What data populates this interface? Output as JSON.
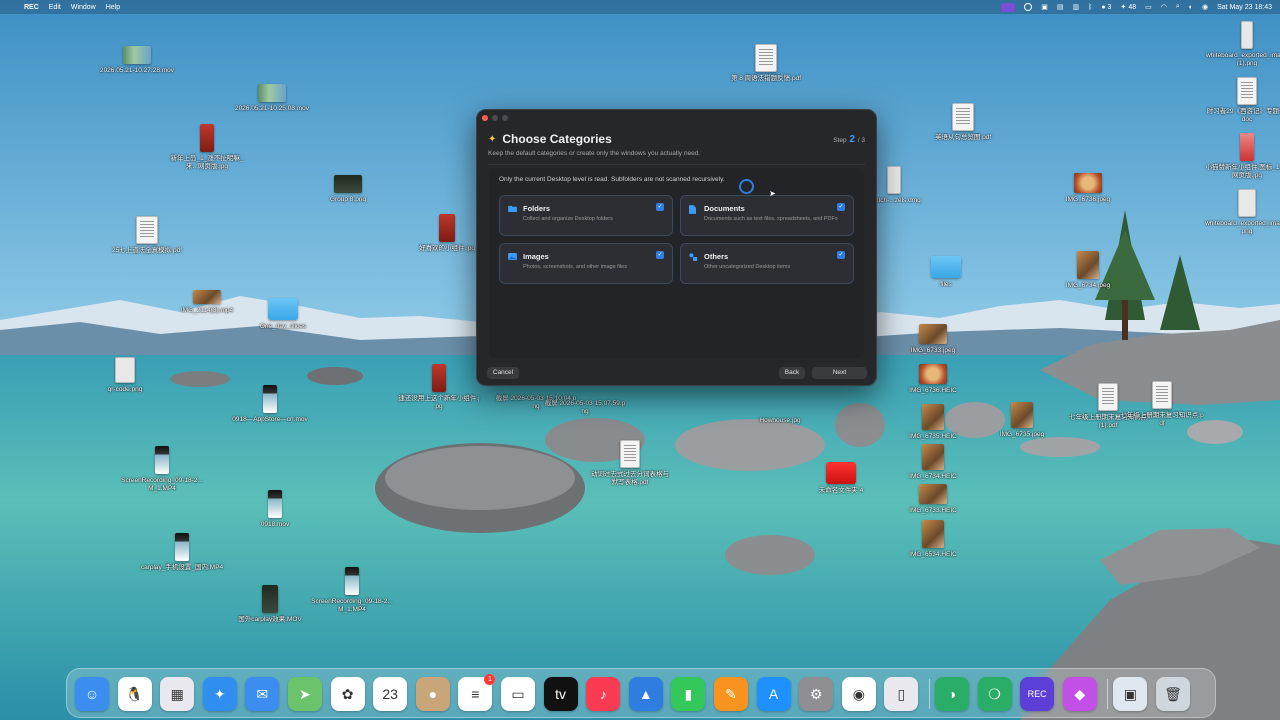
{
  "menubar": {
    "app_name": "REC",
    "menus": [
      "Edit",
      "Window",
      "Help"
    ],
    "notif_count": "3",
    "wechat_count": "48",
    "datetime": "Sat May 23  18:43"
  },
  "desktop_icons": [
    {
      "label": "2026.05.21-10.27.28.mov",
      "type": "video"
    },
    {
      "label": "2026.05.21-10.25.08.mov",
      "type": "video"
    },
    {
      "label": "新年上岛_1_涨不扯呢嘛_来...网页版.jpg",
      "type": "red"
    },
    {
      "label": "Group 8.png",
      "type": "dark"
    },
    {
      "label": "25七上道法全真模拟.pdf",
      "type": "doc"
    },
    {
      "label": "好喜欢的小组件.jpg",
      "type": "red"
    },
    {
      "label": "IMG_2114(3).mp4",
      "type": "photo"
    },
    {
      "label": "One_day_slices",
      "type": "folder"
    },
    {
      "label": "qr-code.png",
      "type": "gray"
    },
    {
      "label": "0918—AppStore—cn.mov",
      "type": "phone"
    },
    {
      "label": "速还没用上这个新年小组件.jpg",
      "type": "red"
    },
    {
      "label": "截屏 2026-05-03 15.10.04.png",
      "type": "gray"
    },
    {
      "label": "截屏 2026-05-03 15.07.59.png",
      "type": "gray"
    },
    {
      "label": "ScreenRecording_09-18-2...M_1.MP4",
      "type": "phone"
    },
    {
      "label": "0918.mov",
      "type": "phone"
    },
    {
      "label": "carplay_手机设置_国内.MP4",
      "type": "phone"
    },
    {
      "label": "ScreenRecording_09-18-2...M_1.MP4",
      "type": "phone"
    },
    {
      "label": "国外carplay效果.MOV",
      "type": "dark"
    },
    {
      "label": "动词过去式过去分词表格与默写表格.pdf",
      "type": "doc"
    },
    {
      "label": "第 8 周语法错题反馈.pdf",
      "type": "doc"
    },
    {
      "label": "英语从句总览图.pdf",
      "type": "doc"
    },
    {
      "label": "Sketch-...zels.dmg",
      "type": "gray"
    },
    {
      "label": "IMG_6736.jpeg",
      "type": "food"
    },
    {
      "label": "IMG_6734.jpeg",
      "type": "photo"
    },
    {
      "label": "files",
      "type": "folder"
    },
    {
      "label": "IMG_6733.jpeg",
      "type": "photo"
    },
    {
      "label": "IMG_6736.HEIC",
      "type": "food"
    },
    {
      "label": "IMG_6735.HEIC",
      "type": "photo"
    },
    {
      "label": "IMG_6735.jpeg",
      "type": "photo"
    },
    {
      "label": "IMG_6734.HEIC",
      "type": "photo"
    },
    {
      "label": "IMG_6733.HEIC",
      "type": "photo"
    },
    {
      "label": "IMG_6534.HEIC",
      "type": "photo"
    },
    {
      "label": "Howhouse.jpg",
      "type": "gray"
    },
    {
      "label": "未命名文件夹 4",
      "type": "folder-red"
    },
    {
      "label": "七年级上册期末复习知识点 (1).pdf",
      "type": "doc"
    },
    {
      "label": "七年级上册期末复习知识点.pdf",
      "type": "doc"
    },
    {
      "label": "whiteboard_exported_image (1).png",
      "type": "gray"
    },
    {
      "label": "时习者29《西游记》专题一.doc",
      "type": "doc"
    },
    {
      "label": "小猫赞新年小组件,图标_1_...网页版.jpg",
      "type": "pinkish"
    },
    {
      "label": "whiteboard_exported_image.png",
      "type": "gray"
    }
  ],
  "dialog": {
    "title": "Choose Categories",
    "step_label": "Step",
    "step_current": "2",
    "step_total": "/ 3",
    "subtitle": "Keep the default categories or create only the windows you actually need.",
    "note": "Only the current Desktop level is read. Subfolders are not scanned recursively.",
    "categories": [
      {
        "name": "Folders",
        "desc": "Collect and organize Desktop folders",
        "checked": true
      },
      {
        "name": "Documents",
        "desc": "Documents such as text files, spreadsheets, and PDFs",
        "checked": true
      },
      {
        "name": "Images",
        "desc": "Photos, screenshots, and other image files",
        "checked": true
      },
      {
        "name": "Others",
        "desc": "Other uncategorized Desktop items",
        "checked": true
      }
    ],
    "cancel_label": "Cancel",
    "back_label": "Back",
    "next_label": "Next"
  },
  "dock": {
    "items": [
      {
        "name": "finder-icon",
        "color": "#3b8ef0",
        "glyph": "☺"
      },
      {
        "name": "qq-icon",
        "color": "#ffffff",
        "glyph": "🐧"
      },
      {
        "name": "launchpad-icon",
        "color": "#e8e8ee",
        "glyph": "▦"
      },
      {
        "name": "safari-icon",
        "color": "#2f8ef0",
        "glyph": "✦"
      },
      {
        "name": "mail-icon",
        "color": "#3b8ef0",
        "glyph": "✉"
      },
      {
        "name": "maps-icon",
        "color": "#6bc46b",
        "glyph": "➤"
      },
      {
        "name": "photos-icon",
        "color": "#ffffff",
        "glyph": "✿"
      },
      {
        "name": "calendar-icon",
        "color": "#ffffff",
        "glyph": "23"
      },
      {
        "name": "contacts-icon",
        "color": "#c8a67a",
        "glyph": "●"
      },
      {
        "name": "reminders-icon",
        "color": "#ffffff",
        "glyph": "≡",
        "badge": "1"
      },
      {
        "name": "notes-icon",
        "color": "#ffffff",
        "glyph": "▭"
      },
      {
        "name": "apple-tv-icon",
        "color": "#111111",
        "glyph": "tv"
      },
      {
        "name": "music-icon",
        "color": "#fa3b52",
        "glyph": "♪"
      },
      {
        "name": "keynote-icon",
        "color": "#2f7de1",
        "glyph": "▲"
      },
      {
        "name": "numbers-icon",
        "color": "#34c759",
        "glyph": "▮"
      },
      {
        "name": "pages-icon",
        "color": "#f7931e",
        "glyph": "✎"
      },
      {
        "name": "app-store-icon",
        "color": "#1e90ff",
        "glyph": "A"
      },
      {
        "name": "system-settings-icon",
        "color": "#8e8e93",
        "glyph": "⚙"
      },
      {
        "name": "chrome-icon",
        "color": "#ffffff",
        "glyph": "◉"
      },
      {
        "name": "iphone-mirroring-icon",
        "color": "#e8e8ee",
        "glyph": "▯"
      },
      {
        "name": "wechat-work-icon",
        "color": "#2aae67",
        "glyph": "◑"
      },
      {
        "name": "wechat-icon",
        "color": "#2aae67",
        "glyph": "❍"
      },
      {
        "name": "rec-app-icon",
        "color": "#5b3fd6",
        "glyph": "REC"
      },
      {
        "name": "shortcuts-icon",
        "color": "#c24fe6",
        "glyph": "◆"
      },
      {
        "name": "preview-icon",
        "color": "#dfe8f0",
        "glyph": "▣"
      },
      {
        "name": "trash-icon",
        "color": "#cfd6dc",
        "glyph": "🗑"
      }
    ]
  },
  "colors": {
    "accent": "#2f7de1",
    "dialog_bg": "#262729",
    "card_bg": "#2c2e33"
  }
}
